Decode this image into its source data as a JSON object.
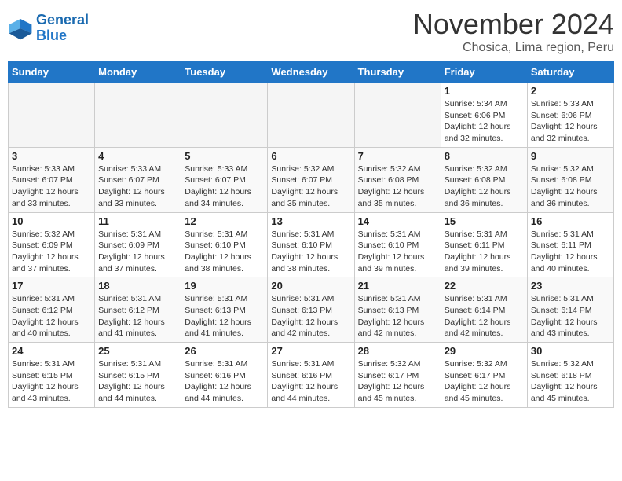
{
  "logo": {
    "line1": "General",
    "line2": "Blue"
  },
  "title": "November 2024",
  "location": "Chosica, Lima region, Peru",
  "weekdays": [
    "Sunday",
    "Monday",
    "Tuesday",
    "Wednesday",
    "Thursday",
    "Friday",
    "Saturday"
  ],
  "weeks": [
    [
      {
        "day": "",
        "sunrise": "",
        "sunset": "",
        "daylight": ""
      },
      {
        "day": "",
        "sunrise": "",
        "sunset": "",
        "daylight": ""
      },
      {
        "day": "",
        "sunrise": "",
        "sunset": "",
        "daylight": ""
      },
      {
        "day": "",
        "sunrise": "",
        "sunset": "",
        "daylight": ""
      },
      {
        "day": "",
        "sunrise": "",
        "sunset": "",
        "daylight": ""
      },
      {
        "day": "1",
        "sunrise": "5:34 AM",
        "sunset": "6:06 PM",
        "daylight": "12 hours and 32 minutes."
      },
      {
        "day": "2",
        "sunrise": "5:33 AM",
        "sunset": "6:06 PM",
        "daylight": "12 hours and 32 minutes."
      }
    ],
    [
      {
        "day": "3",
        "sunrise": "5:33 AM",
        "sunset": "6:07 PM",
        "daylight": "12 hours and 33 minutes."
      },
      {
        "day": "4",
        "sunrise": "5:33 AM",
        "sunset": "6:07 PM",
        "daylight": "12 hours and 33 minutes."
      },
      {
        "day": "5",
        "sunrise": "5:33 AM",
        "sunset": "6:07 PM",
        "daylight": "12 hours and 34 minutes."
      },
      {
        "day": "6",
        "sunrise": "5:32 AM",
        "sunset": "6:07 PM",
        "daylight": "12 hours and 35 minutes."
      },
      {
        "day": "7",
        "sunrise": "5:32 AM",
        "sunset": "6:08 PM",
        "daylight": "12 hours and 35 minutes."
      },
      {
        "day": "8",
        "sunrise": "5:32 AM",
        "sunset": "6:08 PM",
        "daylight": "12 hours and 36 minutes."
      },
      {
        "day": "9",
        "sunrise": "5:32 AM",
        "sunset": "6:08 PM",
        "daylight": "12 hours and 36 minutes."
      }
    ],
    [
      {
        "day": "10",
        "sunrise": "5:32 AM",
        "sunset": "6:09 PM",
        "daylight": "12 hours and 37 minutes."
      },
      {
        "day": "11",
        "sunrise": "5:31 AM",
        "sunset": "6:09 PM",
        "daylight": "12 hours and 37 minutes."
      },
      {
        "day": "12",
        "sunrise": "5:31 AM",
        "sunset": "6:10 PM",
        "daylight": "12 hours and 38 minutes."
      },
      {
        "day": "13",
        "sunrise": "5:31 AM",
        "sunset": "6:10 PM",
        "daylight": "12 hours and 38 minutes."
      },
      {
        "day": "14",
        "sunrise": "5:31 AM",
        "sunset": "6:10 PM",
        "daylight": "12 hours and 39 minutes."
      },
      {
        "day": "15",
        "sunrise": "5:31 AM",
        "sunset": "6:11 PM",
        "daylight": "12 hours and 39 minutes."
      },
      {
        "day": "16",
        "sunrise": "5:31 AM",
        "sunset": "6:11 PM",
        "daylight": "12 hours and 40 minutes."
      }
    ],
    [
      {
        "day": "17",
        "sunrise": "5:31 AM",
        "sunset": "6:12 PM",
        "daylight": "12 hours and 40 minutes."
      },
      {
        "day": "18",
        "sunrise": "5:31 AM",
        "sunset": "6:12 PM",
        "daylight": "12 hours and 41 minutes."
      },
      {
        "day": "19",
        "sunrise": "5:31 AM",
        "sunset": "6:13 PM",
        "daylight": "12 hours and 41 minutes."
      },
      {
        "day": "20",
        "sunrise": "5:31 AM",
        "sunset": "6:13 PM",
        "daylight": "12 hours and 42 minutes."
      },
      {
        "day": "21",
        "sunrise": "5:31 AM",
        "sunset": "6:13 PM",
        "daylight": "12 hours and 42 minutes."
      },
      {
        "day": "22",
        "sunrise": "5:31 AM",
        "sunset": "6:14 PM",
        "daylight": "12 hours and 42 minutes."
      },
      {
        "day": "23",
        "sunrise": "5:31 AM",
        "sunset": "6:14 PM",
        "daylight": "12 hours and 43 minutes."
      }
    ],
    [
      {
        "day": "24",
        "sunrise": "5:31 AM",
        "sunset": "6:15 PM",
        "daylight": "12 hours and 43 minutes."
      },
      {
        "day": "25",
        "sunrise": "5:31 AM",
        "sunset": "6:15 PM",
        "daylight": "12 hours and 44 minutes."
      },
      {
        "day": "26",
        "sunrise": "5:31 AM",
        "sunset": "6:16 PM",
        "daylight": "12 hours and 44 minutes."
      },
      {
        "day": "27",
        "sunrise": "5:31 AM",
        "sunset": "6:16 PM",
        "daylight": "12 hours and 44 minutes."
      },
      {
        "day": "28",
        "sunrise": "5:32 AM",
        "sunset": "6:17 PM",
        "daylight": "12 hours and 45 minutes."
      },
      {
        "day": "29",
        "sunrise": "5:32 AM",
        "sunset": "6:17 PM",
        "daylight": "12 hours and 45 minutes."
      },
      {
        "day": "30",
        "sunrise": "5:32 AM",
        "sunset": "6:18 PM",
        "daylight": "12 hours and 45 minutes."
      }
    ]
  ],
  "labels": {
    "sunrise": "Sunrise:",
    "sunset": "Sunset:",
    "daylight": "Daylight:"
  }
}
